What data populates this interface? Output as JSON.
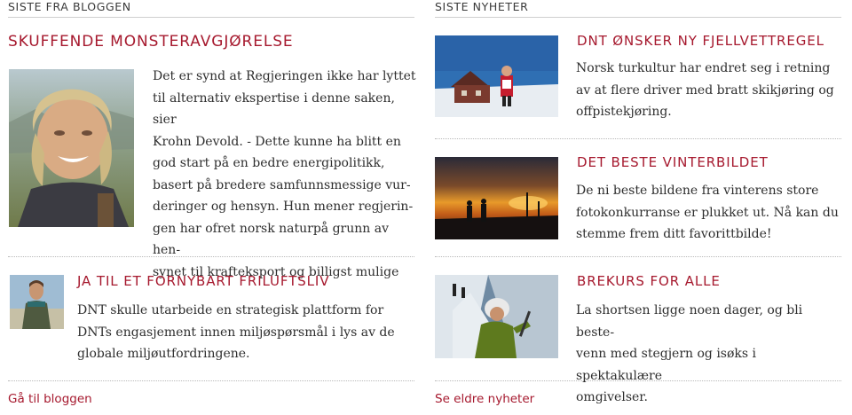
{
  "blog": {
    "section_title": "SISTE FRA BLOGGEN",
    "featured": {
      "title": "SKUFFENDE MONSTERAVGJØRELSE",
      "image_alt": "portrait-woman",
      "lines": [
        "Det er synd at Regjeringen ikke har lyttet",
        "til alternativ ekspertise i denne saken, sier",
        "Krohn Devold. - Dette kunne ha blitt en",
        "god start på en bedre energipolitikk,",
        "basert på bredere samfunnsmessige vur-",
        "deringer og hensyn. Hun mener regjerin-",
        "gen har ofret norsk naturpå grunn av hen-",
        "synet til krafteksport og billigst mulige"
      ]
    },
    "second": {
      "title": "JA TIL ET FORNYBART FRILUFTSLIV",
      "lines": [
        "DNT skulle utarbeide en strategisk plattform for",
        "DNTs engasjement innen miljøspørsmål i lys av de",
        "globale miljøutfordringene."
      ]
    },
    "footer_link": "Gå til bloggen"
  },
  "news": {
    "section_title": "SISTE NYHETER",
    "items": [
      {
        "title": "DNT ØNSKER NY FJELLVETTREGEL",
        "lines": [
          "Norsk turkultur har endret seg i retning",
          "av at flere driver med bratt skikjøring og",
          "offpistekjøring."
        ]
      },
      {
        "title": "DET BESTE VINTERBILDET",
        "lines": [
          "De ni beste bildene fra vinterens store",
          "fotokonkurranse er plukket ut. Nå kan du",
          "stemme frem ditt favorittbilde!"
        ]
      },
      {
        "title": "BREKURS FOR ALLE",
        "lines": [
          "La shortsen ligge noen dager, og bli beste-",
          "venn med stegjern og isøks i spektakulære",
          "omgivelser."
        ]
      }
    ],
    "footer_link": "Se eldre nyheter"
  },
  "colors": {
    "accent": "#a6192e",
    "text": "#2e2e2e",
    "rule": "#cfcfcf"
  }
}
